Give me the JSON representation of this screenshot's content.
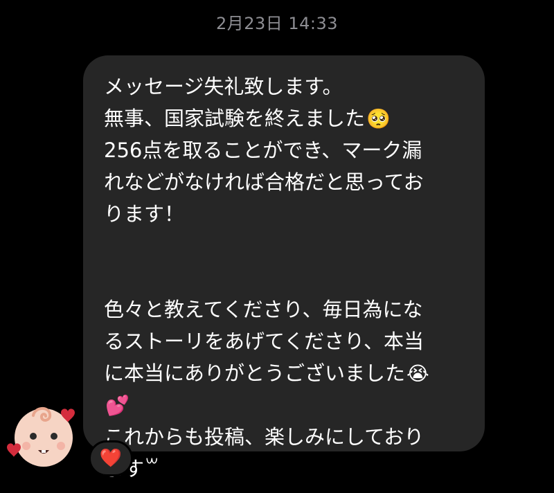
{
  "header": {
    "timestamp": "2月23日 14:33"
  },
  "message": {
    "lines": [
      {
        "text": "メッセージ失礼致します。",
        "emoji": ""
      },
      {
        "text": "無事、国家試験を終えました",
        "emoji": "🥺"
      },
      {
        "text": "256点を取ることができ、マーク漏",
        "emoji": ""
      },
      {
        "text": "れなどがなければ合格だと思ってお",
        "emoji": ""
      },
      {
        "text": "ります！",
        "emoji": ""
      },
      {
        "text": "",
        "emoji": ""
      },
      {
        "text": "",
        "emoji": ""
      },
      {
        "text": "色々と教えてくださり、毎日為にな",
        "emoji": ""
      },
      {
        "text": "るストーリをあげてくださり、本当",
        "emoji": ""
      },
      {
        "text": "に本当にありがとうございました",
        "emoji": "😭"
      },
      {
        "text": "",
        "emoji": "💕"
      },
      {
        "text": "これからも投稿、楽しみにしており",
        "emoji": ""
      },
      {
        "text": "ます꒳",
        "emoji": ""
      }
    ]
  },
  "reaction": {
    "emoji": "❤️"
  },
  "avatar": {
    "icon": "baby-face-icon"
  },
  "colors": {
    "background": "#000000",
    "bubble": "#262626",
    "timestamp": "#8e8e93"
  }
}
